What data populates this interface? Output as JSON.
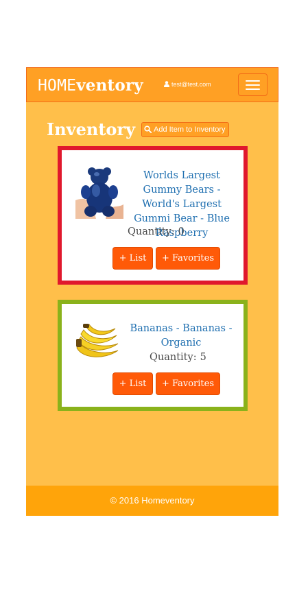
{
  "navbar": {
    "brand_part1": "HOME",
    "brand_part2": "ventory",
    "user_email": "test@test.com",
    "user_icon": "user-icon",
    "menu_icon": "hamburger-menu-icon"
  },
  "page": {
    "title": "Inventory",
    "add_button_label": "Add Item to Inventory",
    "add_button_icon": "search-icon"
  },
  "items": [
    {
      "name": "Worlds Largest Gummy Bears - World's Largest Gummi Bear - Blue Raspberry",
      "quantity_label": "Quantity:",
      "quantity": "0",
      "list_button": "+ List",
      "favorites_button": "+ Favorites",
      "border_color": "#e0182d",
      "image": "blue-gummy-bear-image"
    },
    {
      "name": "Bananas - Bananas - Organic",
      "quantity_label": "Quantity:",
      "quantity": "5",
      "list_button": "+ List",
      "favorites_button": "+ Favorites",
      "border_color": "#8ab21b",
      "image": "bananas-image"
    }
  ],
  "footer": {
    "text": "© 2016 Homeventory"
  },
  "colors": {
    "background": "#ffbf4a",
    "navbar": "#ffa024",
    "button": "#ff5a08",
    "link": "#1f6fb0"
  }
}
